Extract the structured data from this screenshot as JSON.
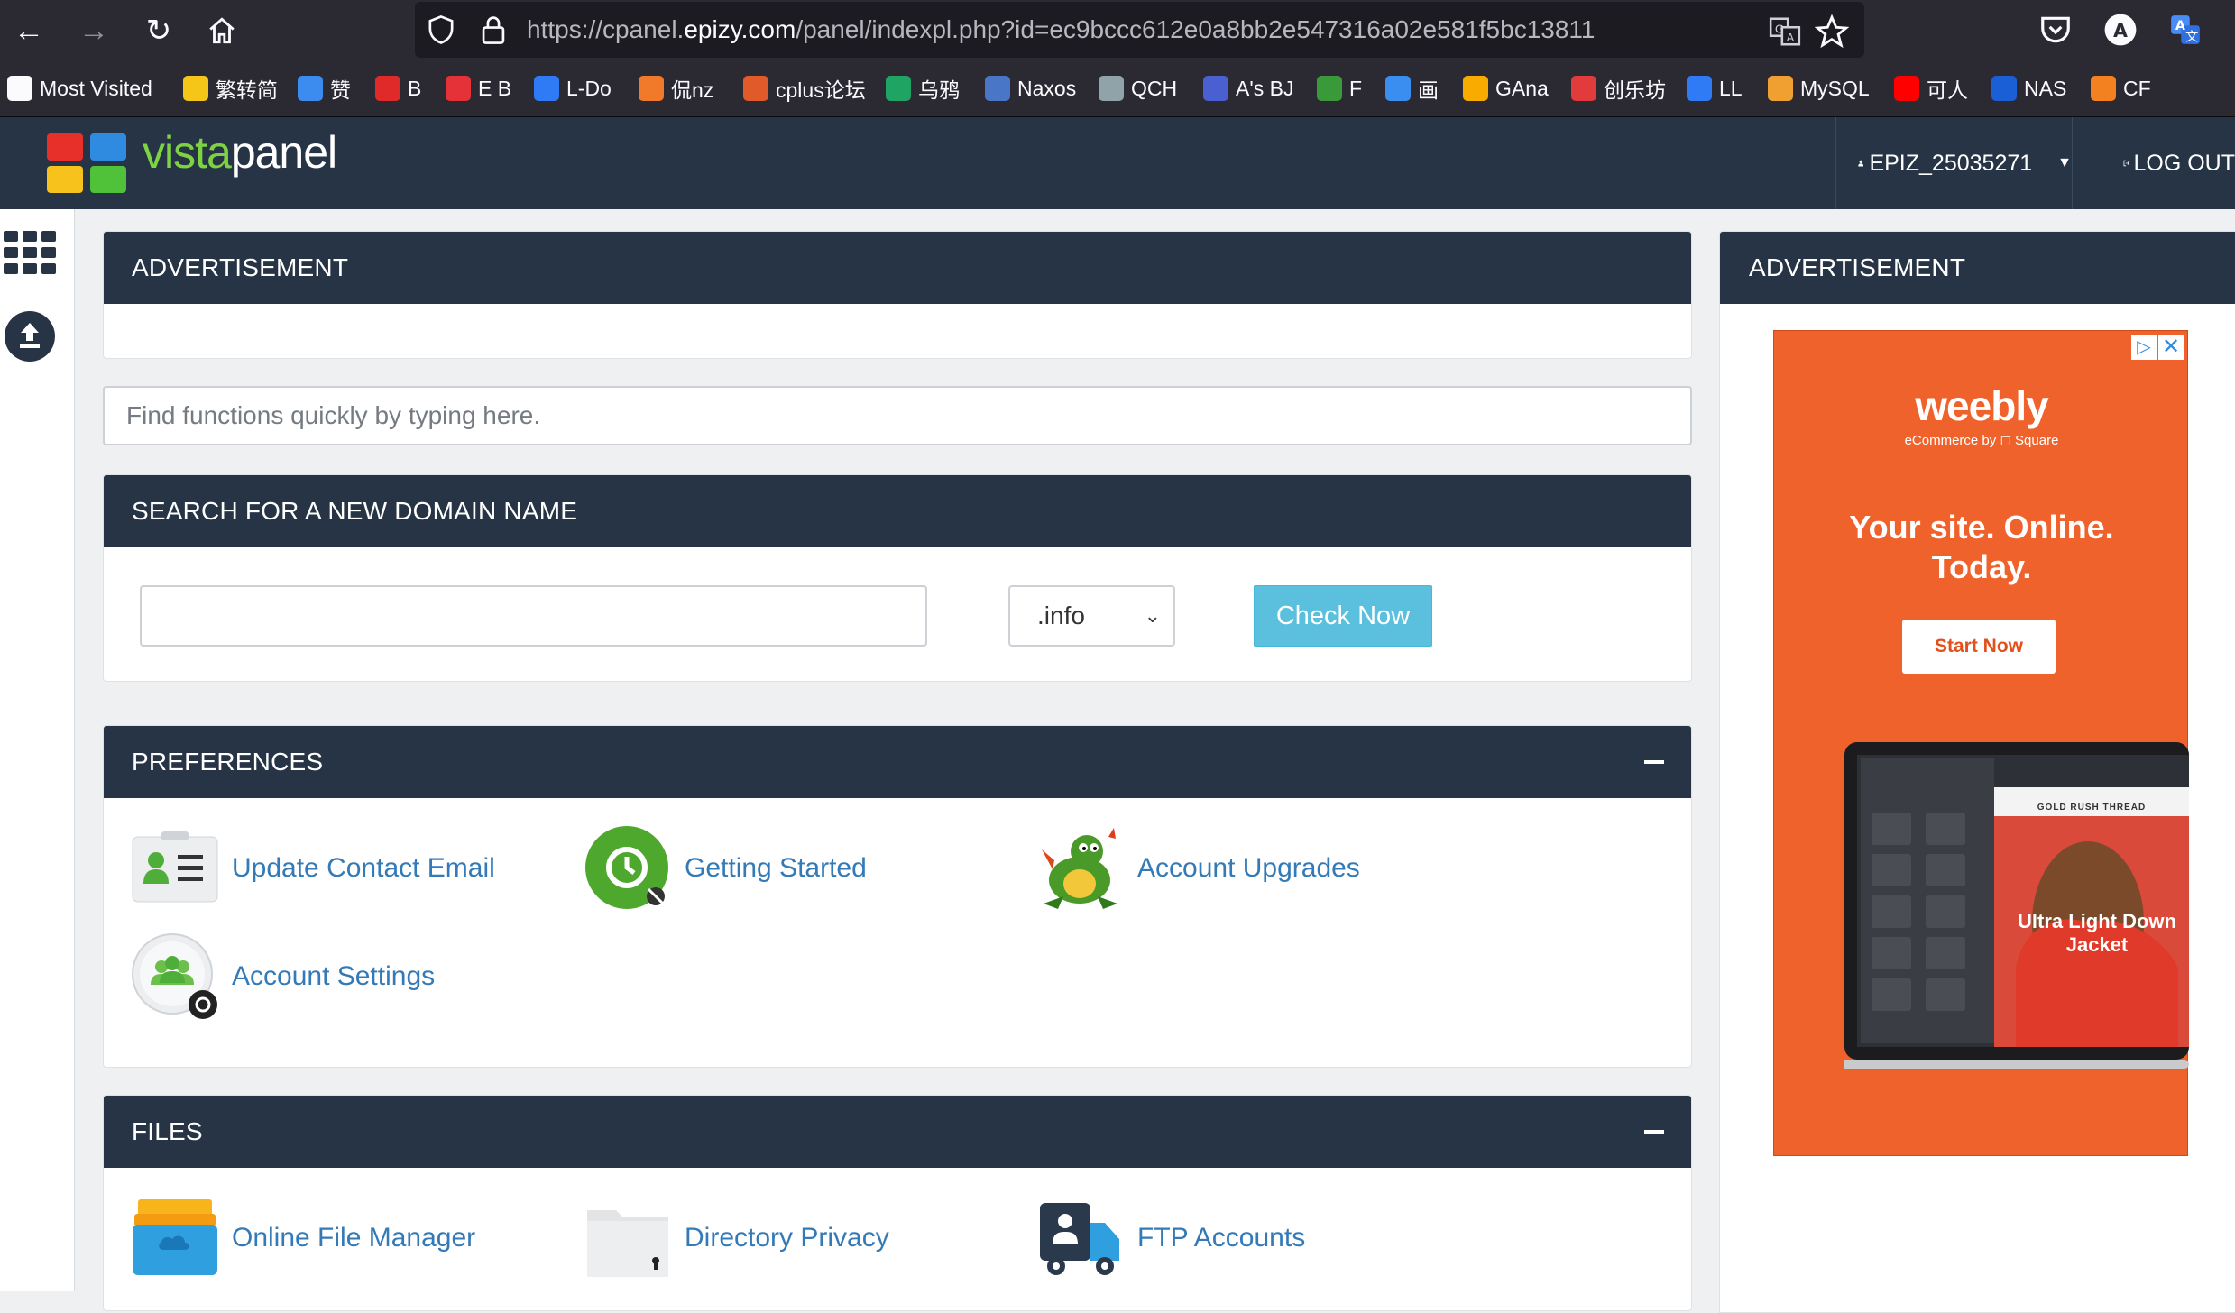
{
  "browser": {
    "url_pre": "https://cpanel.",
    "url_domain": "epizy.com",
    "url_post": "/panel/indexpl.php?id=ec9bccc612e0a8bb2e547316a02e581f5bc13811",
    "bookmarks": [
      {
        "label": "Most Visited",
        "icon": "gear-icon",
        "color": "#fbfbfe"
      },
      {
        "label": "繁转简",
        "icon": "crown-icon",
        "color": "#f5c518"
      },
      {
        "label": "赞",
        "icon": "thumb-icon",
        "color": "#3c8cf0"
      },
      {
        "label": "B",
        "icon": "b-icon",
        "color": "#e02a2a"
      },
      {
        "label": "E B",
        "icon": "ebay-icon",
        "color": "#e53238"
      },
      {
        "label": "L-Do",
        "icon": "cloud-icon",
        "color": "#2f7bf5"
      },
      {
        "label": "侃nz",
        "icon": "swirl-icon",
        "color": "#f07a2a"
      },
      {
        "label": "cplus论坛",
        "icon": "c-icon",
        "color": "#e05a2a"
      },
      {
        "label": "乌鸦",
        "icon": "crow-icon",
        "color": "#1fa463"
      },
      {
        "label": "Naxos",
        "icon": "temple-icon",
        "color": "#4a76c8"
      },
      {
        "label": "QCH",
        "icon": "photo-icon",
        "color": "#8fa3a8"
      },
      {
        "label": "A's BJ",
        "icon": "window-icon",
        "color": "#4a5fd0"
      },
      {
        "label": "F",
        "icon": "leaf-icon",
        "color": "#3a9a3a"
      },
      {
        "label": "画",
        "icon": "c-circle-icon",
        "color": "#3a8ef0"
      },
      {
        "label": "GAna",
        "icon": "analytics-icon",
        "color": "#f9ab00"
      },
      {
        "label": "创乐坊",
        "icon": "flame-icon",
        "color": "#e23b3b"
      },
      {
        "label": "LL",
        "icon": "play-icon",
        "color": "#2f7bf5"
      },
      {
        "label": "MySQL",
        "icon": "tower-icon",
        "color": "#f0a030"
      },
      {
        "label": "可人",
        "icon": "youtube-icon",
        "color": "#ff0000"
      },
      {
        "label": "NAS",
        "icon": "dsm-icon",
        "color": "#1a5fd6"
      },
      {
        "label": "CF",
        "icon": "cloudflare-icon",
        "color": "#f48120"
      }
    ]
  },
  "header": {
    "brand_v": "vista",
    "brand_rest": "panel",
    "username": "EPIZ_25035271",
    "logout_label": "LOG OUT"
  },
  "main": {
    "ad_title": "ADVERTISEMENT",
    "search_placeholder": "Find functions quickly by typing here.",
    "domain_title": "SEARCH FOR A NEW DOMAIN NAME",
    "tld_selected": ".info",
    "check_label": "Check Now",
    "preferences": {
      "title": "PREFERENCES",
      "items": [
        {
          "label": "Update Contact Email",
          "icon": "contact-card-icon"
        },
        {
          "label": "Getting Started",
          "icon": "getting-started-icon"
        },
        {
          "label": "Account Upgrades",
          "icon": "dragon-icon"
        },
        {
          "label": "Account Settings",
          "icon": "account-settings-icon"
        }
      ]
    },
    "files": {
      "title": "FILES",
      "items": [
        {
          "label": "Online File Manager",
          "icon": "file-box-icon"
        },
        {
          "label": "Directory Privacy",
          "icon": "folder-lock-icon"
        },
        {
          "label": "FTP Accounts",
          "icon": "ftp-truck-icon"
        }
      ]
    }
  },
  "sidebar_ad": {
    "title": "ADVERTISEMENT",
    "logo": "weebly",
    "sub": "eCommerce by ◻ Square",
    "tagline": "Your site. Online. Today.",
    "cta": "Start Now",
    "laptop_heading": "GOLD RUSH THREAD",
    "laptop_product": "Ultra Light Down Jacket"
  },
  "colors": {
    "header_bg": "#263445",
    "link": "#337ab7",
    "check_btn": "#5bc0de",
    "ad_bg": "#f0622b"
  }
}
